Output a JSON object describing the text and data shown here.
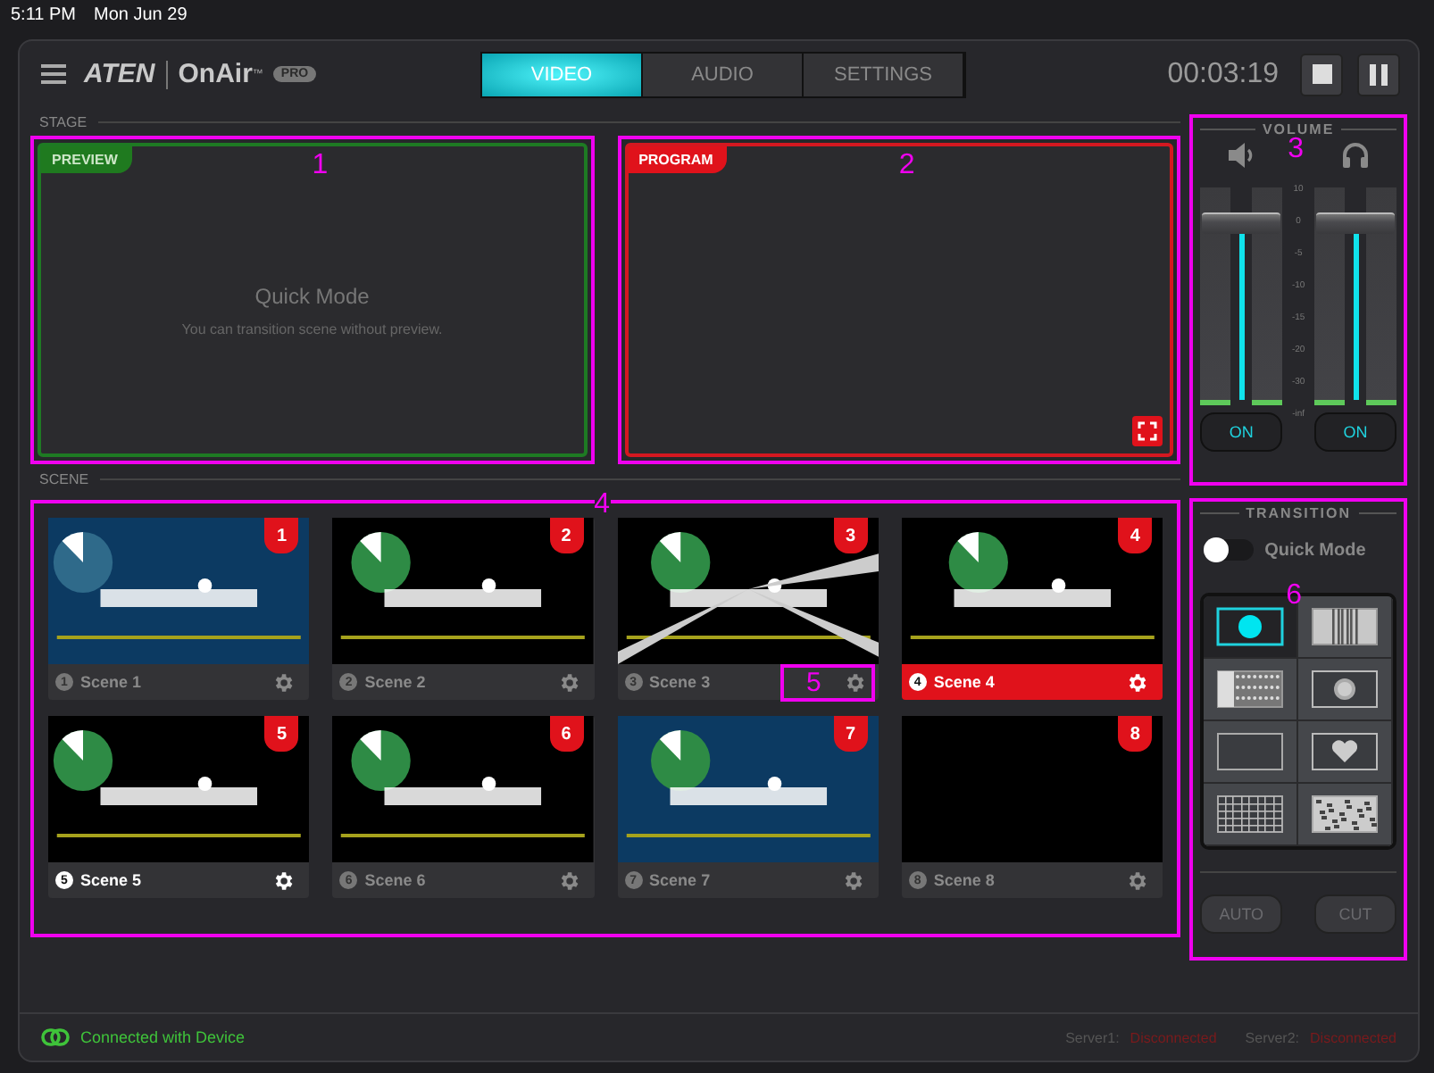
{
  "status_bar": {
    "time": "5:11 PM",
    "date": "Mon Jun 29"
  },
  "header": {
    "logo": "ATEN",
    "product": "OnAir",
    "trademark": "™",
    "edition": "PRO",
    "timer": "00:03:19"
  },
  "tabs": [
    {
      "label": "VIDEO",
      "selected": true
    },
    {
      "label": "AUDIO",
      "selected": false
    },
    {
      "label": "SETTINGS",
      "selected": false
    }
  ],
  "stage": {
    "title": "STAGE",
    "preview": {
      "label": "PREVIEW",
      "title": "Quick Mode",
      "message": "You can transition scene without preview.",
      "callout": "1"
    },
    "program": {
      "label": "PROGRAM",
      "callout": "2"
    }
  },
  "volume": {
    "title": "VOLUME",
    "callout": "3",
    "scale": [
      "10",
      "0",
      "-5",
      "-10",
      "-15",
      "-20",
      "-30",
      "-inf"
    ],
    "channels": [
      {
        "kind": "speaker",
        "level": 0.85,
        "on": true,
        "button": "ON"
      },
      {
        "kind": "headphones",
        "level": 0.85,
        "on": true,
        "button": "ON"
      }
    ]
  },
  "scene": {
    "title": "SCENE",
    "callout": "4",
    "scenes": [
      {
        "badge": "1",
        "index": "1",
        "name": "Scene 1",
        "on_program": false,
        "on_preview": false
      },
      {
        "badge": "2",
        "index": "2",
        "name": "Scene 2",
        "on_program": false,
        "on_preview": false
      },
      {
        "badge": "3",
        "index": "3",
        "name": "Scene 3",
        "on_program": false,
        "on_preview": false,
        "gear_callout": "5"
      },
      {
        "badge": "4",
        "index": "4",
        "name": "Scene 4",
        "on_program": true,
        "on_preview": false
      },
      {
        "badge": "5",
        "index": "5",
        "name": "Scene 5",
        "on_program": false,
        "on_preview": true
      },
      {
        "badge": "6",
        "index": "6",
        "name": "Scene 6",
        "on_program": false,
        "on_preview": false
      },
      {
        "badge": "7",
        "index": "7",
        "name": "Scene 7",
        "on_program": false,
        "on_preview": false
      },
      {
        "badge": "8",
        "index": "8",
        "name": "Scene 8",
        "on_program": false,
        "on_preview": false
      }
    ]
  },
  "transition": {
    "title": "TRANSITION",
    "callout": "6",
    "quick_mode": {
      "label": "Quick Mode",
      "on": false
    },
    "effects": [
      {
        "kind": "circle",
        "selected": true
      },
      {
        "kind": "bars",
        "selected": false
      },
      {
        "kind": "dither",
        "selected": false
      },
      {
        "kind": "glow",
        "selected": false
      },
      {
        "kind": "plain",
        "selected": false
      },
      {
        "kind": "heart",
        "selected": false
      },
      {
        "kind": "grid",
        "selected": false
      },
      {
        "kind": "noise",
        "selected": false
      }
    ],
    "buttons": [
      {
        "label": "AUTO",
        "disabled": true
      },
      {
        "label": "CUT",
        "disabled": true
      }
    ]
  },
  "footer": {
    "connection": "Connected with Device",
    "servers": [
      {
        "label": "Server1:",
        "status": "Disconnected"
      },
      {
        "label": "Server2:",
        "status": "Disconnected"
      }
    ]
  }
}
